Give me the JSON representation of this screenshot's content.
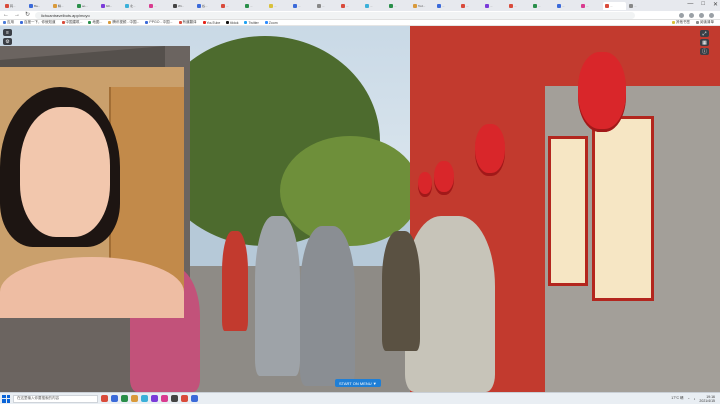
{
  "browser": {
    "tabs": [
      {
        "label": "韩...",
        "color": "#d94b3b"
      },
      {
        "label": "Ba...",
        "color": "#3b6ad9"
      },
      {
        "label": "精...",
        "color": "#d99a3b"
      },
      {
        "label": "ao...",
        "color": "#2a8f4a"
      },
      {
        "label": "bill...",
        "color": "#7b3bd9"
      },
      {
        "label": "北...",
        "color": "#3bb0d9"
      },
      {
        "label": "...",
        "color": "#d93b8f"
      },
      {
        "label": "Wi...",
        "color": "#444444"
      },
      {
        "label": "谷...",
        "color": "#3b6ad9"
      },
      {
        "label": "...",
        "color": "#d94b3b"
      },
      {
        "label": "...",
        "color": "#2a8f4a"
      },
      {
        "label": "...",
        "color": "#d9c13b"
      },
      {
        "label": "...",
        "color": "#3b6ad9"
      },
      {
        "label": "...",
        "color": "#888888"
      },
      {
        "label": "...",
        "color": "#d94b3b"
      },
      {
        "label": "...",
        "color": "#3bb0d9"
      },
      {
        "label": "...",
        "color": "#2a8f4a"
      },
      {
        "label": "Tod...",
        "color": "#d99a3b"
      },
      {
        "label": "...",
        "color": "#3b6ad9"
      },
      {
        "label": "...",
        "color": "#d94b3b"
      },
      {
        "label": "...",
        "color": "#7b3bd9"
      },
      {
        "label": "...",
        "color": "#d94b3b"
      },
      {
        "label": "...",
        "color": "#2a8f4a"
      },
      {
        "label": "...",
        "color": "#3b6ad9"
      },
      {
        "label": "...",
        "color": "#d93b8f"
      },
      {
        "label": "...",
        "color": "#d94b3b"
      },
      {
        "label": "...",
        "color": "#888888"
      }
    ],
    "active_tab_index": 25,
    "url": "lichuantravelbots.app/moyo",
    "window_controls": {
      "minimize": "—",
      "maximize": "□",
      "close": "✕"
    }
  },
  "bookmarks": {
    "left": [
      {
        "label": "应用",
        "color": "#4a7bd9"
      },
      {
        "label": "百度一下，你就知道",
        "color": "#3b6ad9"
      },
      {
        "label": "中国建筑...",
        "color": "#d94b3b"
      },
      {
        "label": "地图...",
        "color": "#2a8f4a"
      },
      {
        "label": "腾讯视频 - 中国...",
        "color": "#d99a3b"
      },
      {
        "label": "PPGO - 中国...",
        "color": "#3b6ad9"
      },
      {
        "label": "有道翻译",
        "color": "#d94b3b"
      },
      {
        "label": "YouTube",
        "color": "#e62117"
      },
      {
        "label": "tiktok",
        "color": "#111111"
      },
      {
        "label": "Twitter",
        "color": "#1da1f2"
      },
      {
        "label": "Zoom",
        "color": "#2d8cff"
      }
    ],
    "right": [
      {
        "label": "其他书签",
        "color": "#d9c13b"
      },
      {
        "label": "阅读清单",
        "color": "#888888"
      }
    ]
  },
  "video": {
    "start_menu_label": "START ON MENU ▼"
  },
  "taskbar": {
    "search_placeholder": "在这里输入你要搜索的内容",
    "apps": [
      "#d94b3b",
      "#3b6ad9",
      "#2a8f4a",
      "#d99a3b",
      "#3bb0d9",
      "#7b3bd9",
      "#d93b8f",
      "#444444",
      "#d94b3b",
      "#3b6ad9"
    ],
    "weather": "17°C 晴",
    "time": "19:16",
    "date": "2021/4/15"
  }
}
